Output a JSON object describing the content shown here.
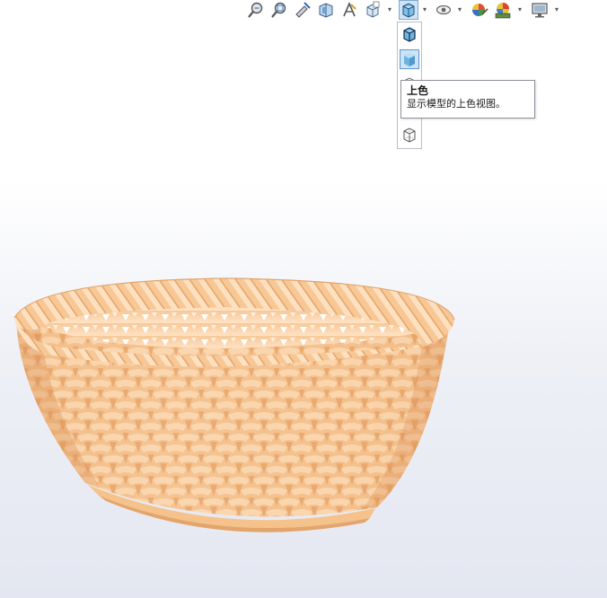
{
  "toolbar": {
    "tools": [
      {
        "name": "zoom-to-fit-icon"
      },
      {
        "name": "zoom-to-area-icon"
      },
      {
        "name": "previous-view-icon"
      },
      {
        "name": "section-view-icon"
      },
      {
        "name": "dynamic-annotation-icon"
      },
      {
        "name": "view-orientation-icon"
      },
      {
        "name": "display-style-icon"
      },
      {
        "name": "hide-show-items-icon"
      },
      {
        "name": "edit-appearance-icon"
      },
      {
        "name": "apply-scene-icon"
      },
      {
        "name": "view-settings-icon"
      }
    ],
    "accent_color": "#5f95cf"
  },
  "display_style_flyout": {
    "items": [
      {
        "name": "shaded-with-edges-icon",
        "selected": false
      },
      {
        "name": "shaded-icon",
        "selected": true
      },
      {
        "name": "hidden-lines-removed-icon",
        "selected": false
      },
      {
        "name": "wireframe-icon",
        "selected": false
      }
    ]
  },
  "tooltip": {
    "title": "上色",
    "description": "显示模型的上色视图。"
  },
  "model": {
    "description_color": "#f5c492",
    "shadow_color": "#c88a55"
  }
}
